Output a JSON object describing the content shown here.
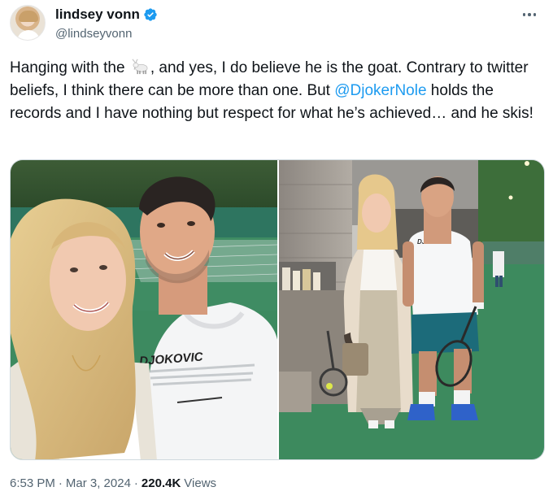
{
  "author": {
    "display_name": "lindsey vonn",
    "handle": "@lindseyvonn",
    "verified": true,
    "avatar_icon": "profile-photo"
  },
  "tweet": {
    "text_part1": "Hanging with the ",
    "emoji": "goat-emoji",
    "text_part2": ", and yes, I do believe he is the goat. Contrary to twitter beliefs, I think there can be more than one. But ",
    "mention": "@DjokerNole",
    "text_part3": " holds the records and I have nothing but respect for what he’s achieved… and he skis!"
  },
  "media": {
    "photo_left": {
      "shirt_text": "DJOKOVIC"
    },
    "photo_right": {
      "shirt_text": "DJOKOVIC"
    }
  },
  "footer": {
    "time": "6:53 PM",
    "sep1": "·",
    "date": "Mar 3, 2024",
    "sep2": "·",
    "views_count": "220.4K",
    "views_label": "Views"
  },
  "colors": {
    "accent": "#1d9bf0",
    "text": "#0f1419",
    "muted": "#536471",
    "court": "#2f8c5a"
  }
}
